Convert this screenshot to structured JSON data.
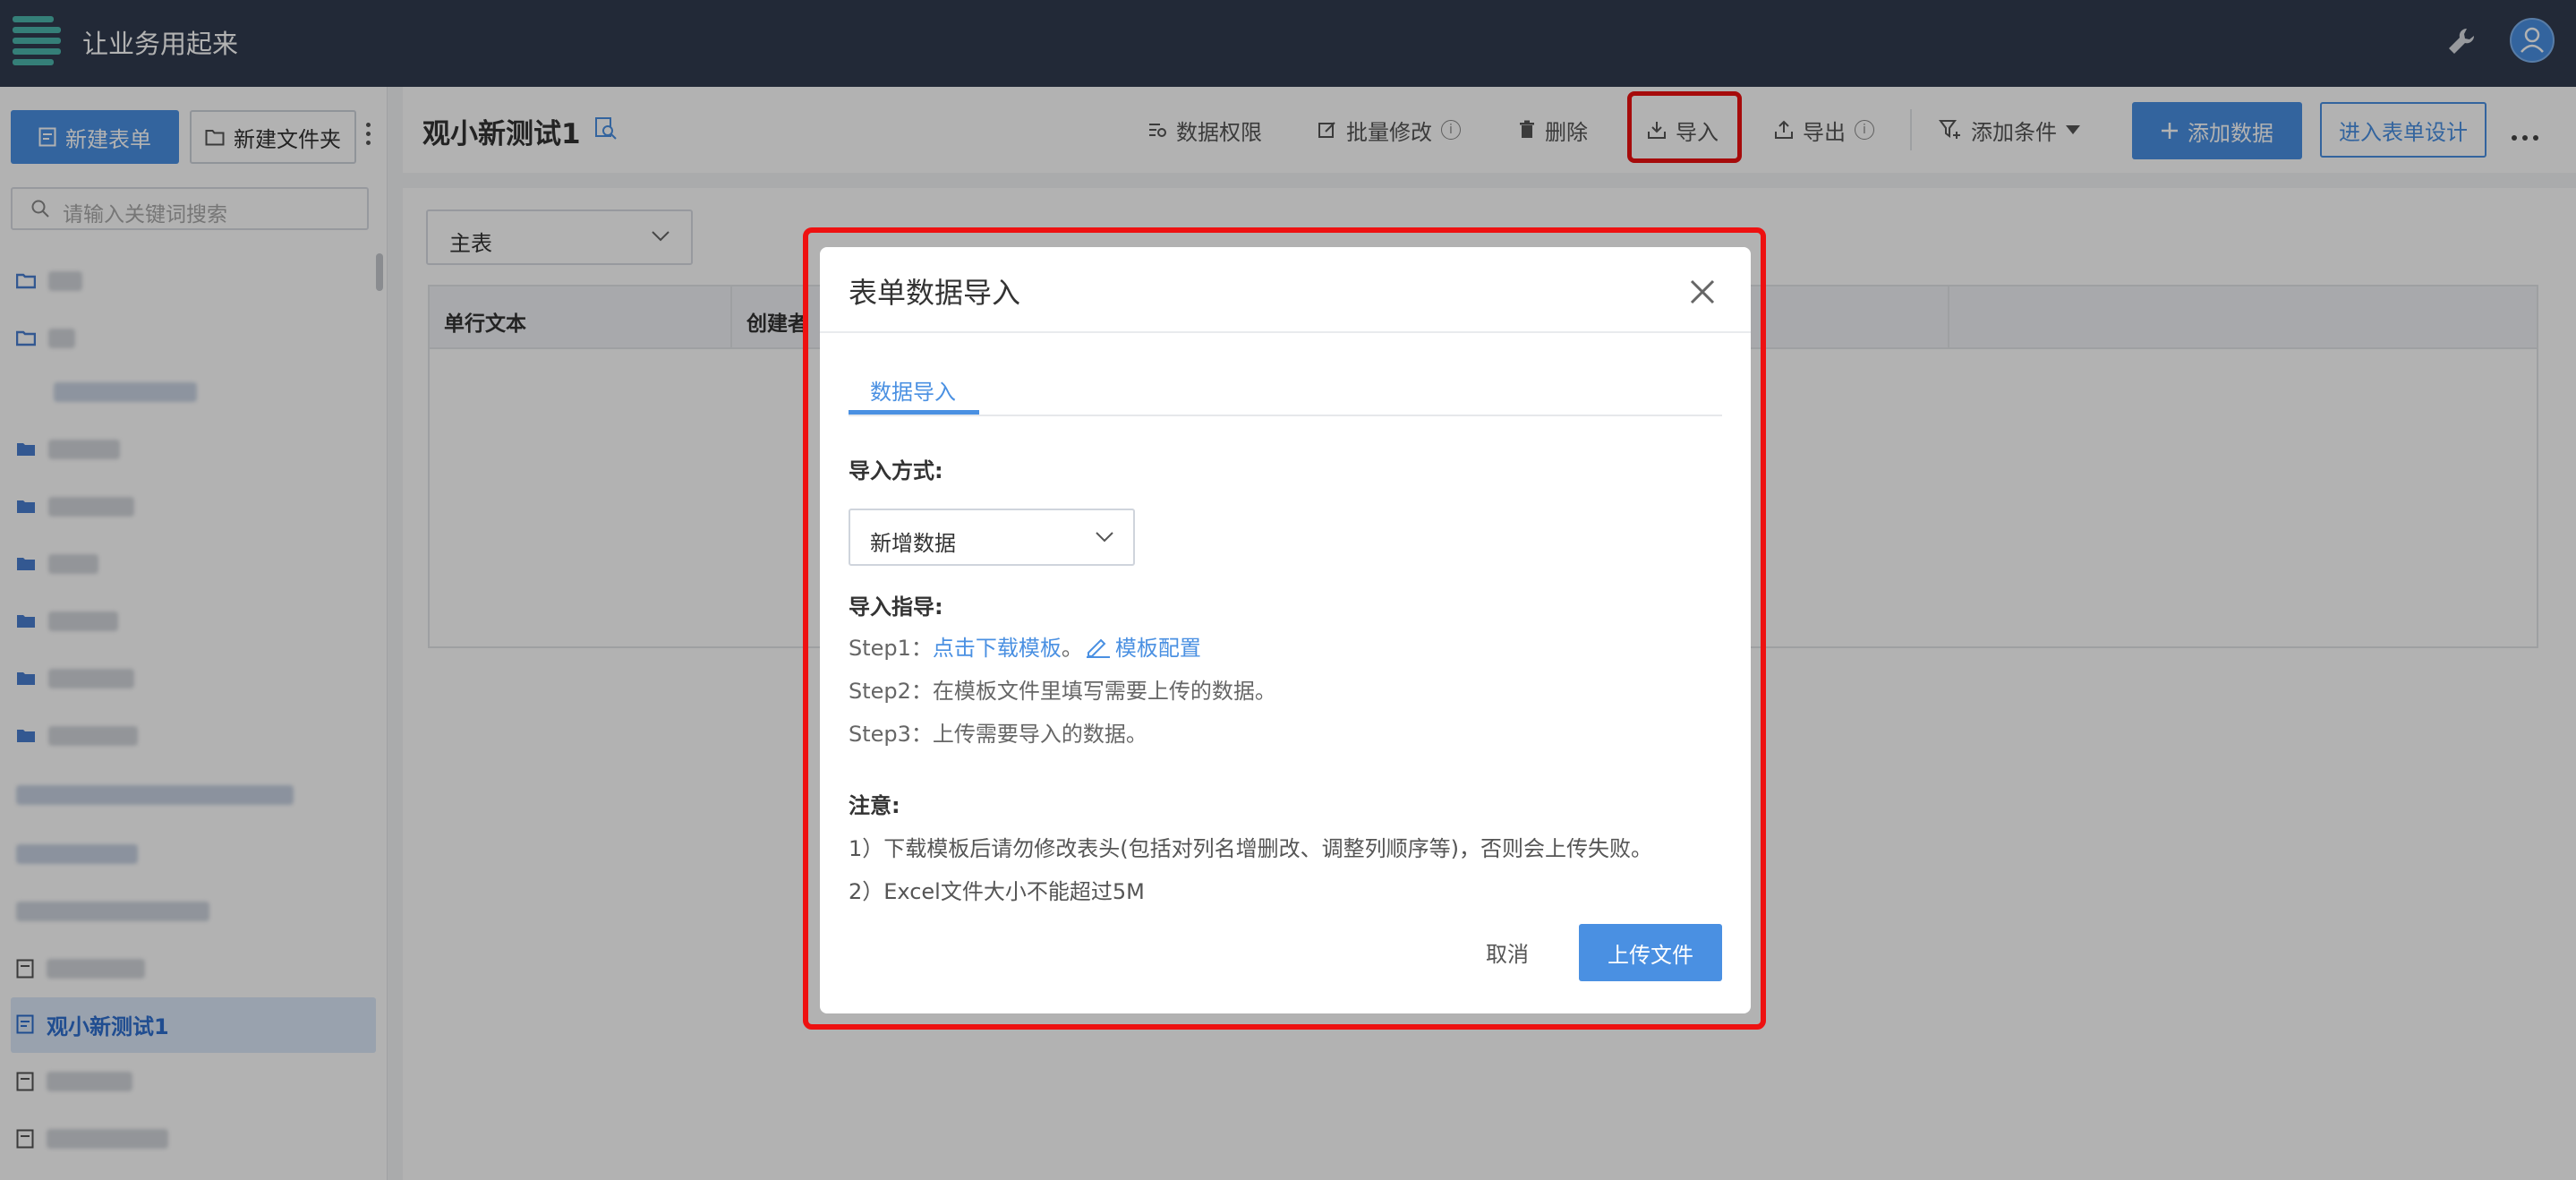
{
  "header": {
    "app_title": "让业务用起来"
  },
  "sidebar": {
    "new_form_label": "新建表单",
    "new_folder_label": "新建文件夹",
    "search_placeholder": "请输入关键词搜索",
    "active_item_label": "观小新测试1"
  },
  "main": {
    "page_title": "观小新测试1",
    "toolbar": {
      "permissions": "数据权限",
      "batch_edit": "批量修改",
      "delete": "删除",
      "import": "导入",
      "export": "导出",
      "add_condition": "添加条件",
      "add_data": "添加数据",
      "enter_design": "进入表单设计"
    },
    "table_selector": "主表",
    "columns": [
      "单行文本",
      "创建者"
    ]
  },
  "modal": {
    "title": "表单数据导入",
    "tab": "数据导入",
    "import_method_label": "导入方式:",
    "import_method_value": "新增数据",
    "guide_label": "导入指导:",
    "step1_prefix": "Step1：",
    "step1_link": "点击下载模板",
    "step1_sep": "。",
    "template_config": "模板配置",
    "step2": "Step2：在模板文件里填写需要上传的数据。",
    "step3": "Step3：上传需要导入的数据。",
    "note_label": "注意:",
    "note1": "1）下载模板后请勿修改表头(包括对列名增删改、调整列顺序等)，否则会上传失败。",
    "note2": "2）Excel文件大小不能超过5M",
    "cancel": "取消",
    "upload": "上传文件"
  },
  "colors": {
    "primary": "#4a90e2",
    "header_bg": "#313b4f",
    "highlight": "#ee1111"
  }
}
